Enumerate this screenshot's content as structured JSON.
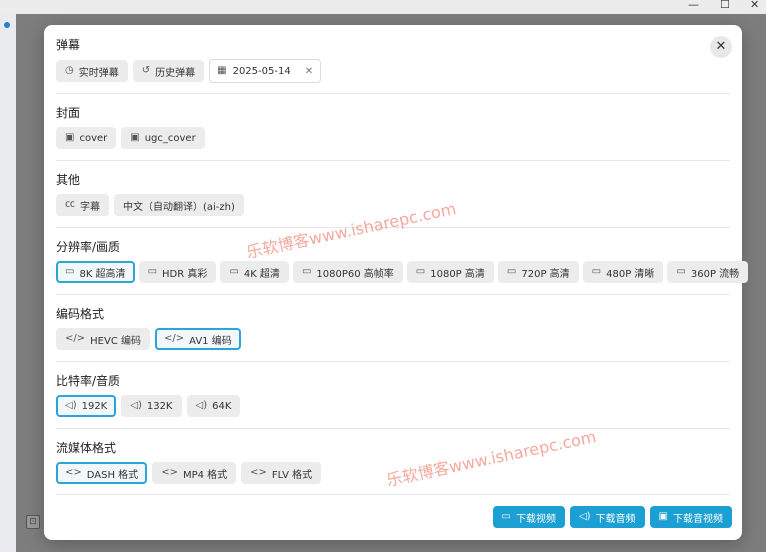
{
  "window": {
    "minimize": "—",
    "maximize": "☐",
    "close": "✕"
  },
  "dialog": {
    "close_icon": "✕"
  },
  "sections": {
    "danmaku": {
      "title": "弹幕",
      "items": [
        {
          "label": "实时弹幕",
          "icon": "clock-icon"
        },
        {
          "label": "历史弹幕",
          "icon": "history-icon"
        }
      ],
      "date": {
        "value": "2025-05-14",
        "icon": "calendar-icon",
        "clear": "✕"
      }
    },
    "cover": {
      "title": "封面",
      "items": [
        {
          "label": "cover",
          "icon": "image-icon"
        },
        {
          "label": "ugc_cover",
          "icon": "image-icon"
        }
      ]
    },
    "other": {
      "title": "其他",
      "items": [
        {
          "label": "字幕",
          "icon": "cc-icon"
        },
        {
          "label": "中文（自动翻译）(ai-zh)",
          "icon": "none"
        }
      ]
    },
    "resolution": {
      "title": "分辨率/画质",
      "items": [
        {
          "label": "8K 超高清",
          "active": true
        },
        {
          "label": "HDR 真彩"
        },
        {
          "label": "4K 超清"
        },
        {
          "label": "1080P60 高帧率"
        },
        {
          "label": "1080P 高清"
        },
        {
          "label": "720P 高清"
        },
        {
          "label": "480P 清晰"
        },
        {
          "label": "360P 流畅"
        }
      ]
    },
    "codec": {
      "title": "编码格式",
      "items": [
        {
          "label": "HEVC 编码"
        },
        {
          "label": "AV1 编码",
          "active": true
        }
      ]
    },
    "bitrate": {
      "title": "比特率/音质",
      "items": [
        {
          "label": "192K",
          "active": true
        },
        {
          "label": "132K"
        },
        {
          "label": "64K"
        }
      ]
    },
    "stream": {
      "title": "流媒体格式",
      "items": [
        {
          "label": "DASH 格式",
          "active": true
        },
        {
          "label": "MP4 格式"
        },
        {
          "label": "FLV 格式"
        }
      ]
    }
  },
  "footer": {
    "download_video": "下载视频",
    "download_audio": "下载音频",
    "download_av": "下载音视频"
  },
  "watermark": "乐软博客www.isharepc.com",
  "colors": {
    "accent": "#1c9fd3",
    "active_border": "#2aa5d6",
    "watermark": "#f07a6a"
  }
}
